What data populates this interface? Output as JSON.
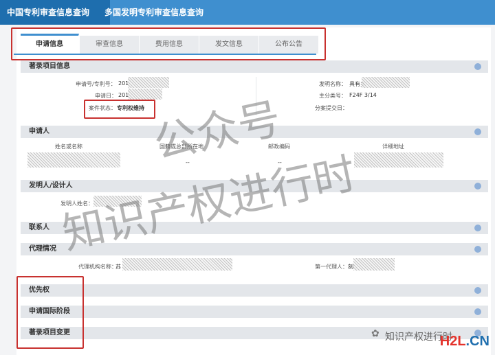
{
  "topbar": {
    "tab1": "中国专利审查信息查询",
    "tab2": "多国发明专利审查信息查询"
  },
  "subtabs": [
    "申请信息",
    "审查信息",
    "费用信息",
    "发文信息",
    "公布公告"
  ],
  "sections": {
    "biblio": "著录项目信息",
    "applicant": "申请人",
    "inventor": "发明人/设计人",
    "contact": "联系人",
    "agency": "代理情况",
    "priority": "优先权",
    "intl": "申请国际阶段",
    "change": "著录项目变更"
  },
  "biblio": {
    "app_no_label": "申请号/专利号：",
    "app_no": "201",
    "app_date_label": "申请日：",
    "app_date": "201",
    "status_label": "案件状态：",
    "status": "专利权维持",
    "title_label": "发明名称：",
    "title": "具有多",
    "ipc_label": "主分类号：",
    "ipc": "F24F 3/14",
    "div_label": "分案提交日："
  },
  "applicant": {
    "cols": [
      "姓名或名称",
      "国籍或总部所在地",
      "邮政编码",
      "详细地址"
    ],
    "row": [
      "--",
      "--"
    ]
  },
  "inventor": {
    "label": "发明人姓名："
  },
  "agency": {
    "agency_label": "代理机构名称：",
    "agency_val": "苏",
    "agent_label": "第一代理人：",
    "agent_val": "刻"
  },
  "watermark": {
    "line1": "公众号",
    "line2": "知识产权进行时",
    "bottom": "知识产权进行时"
  },
  "logo": {
    "a": "H2L",
    "b": ".CN"
  }
}
